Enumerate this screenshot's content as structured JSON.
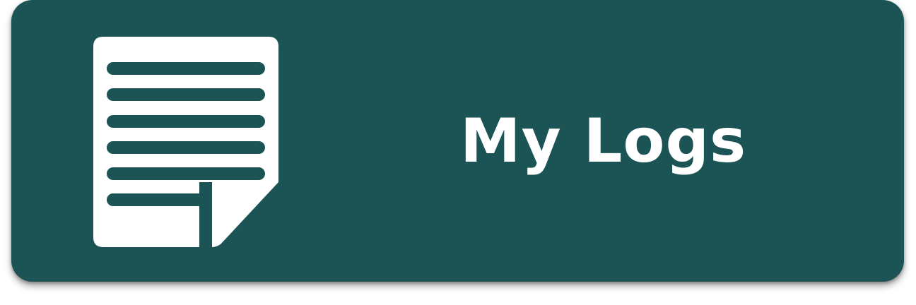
{
  "button": {
    "label": "My Logs",
    "background_color": "#1c5456",
    "foreground_color": "#ffffff"
  },
  "icon": {
    "name": "document-log-icon"
  }
}
